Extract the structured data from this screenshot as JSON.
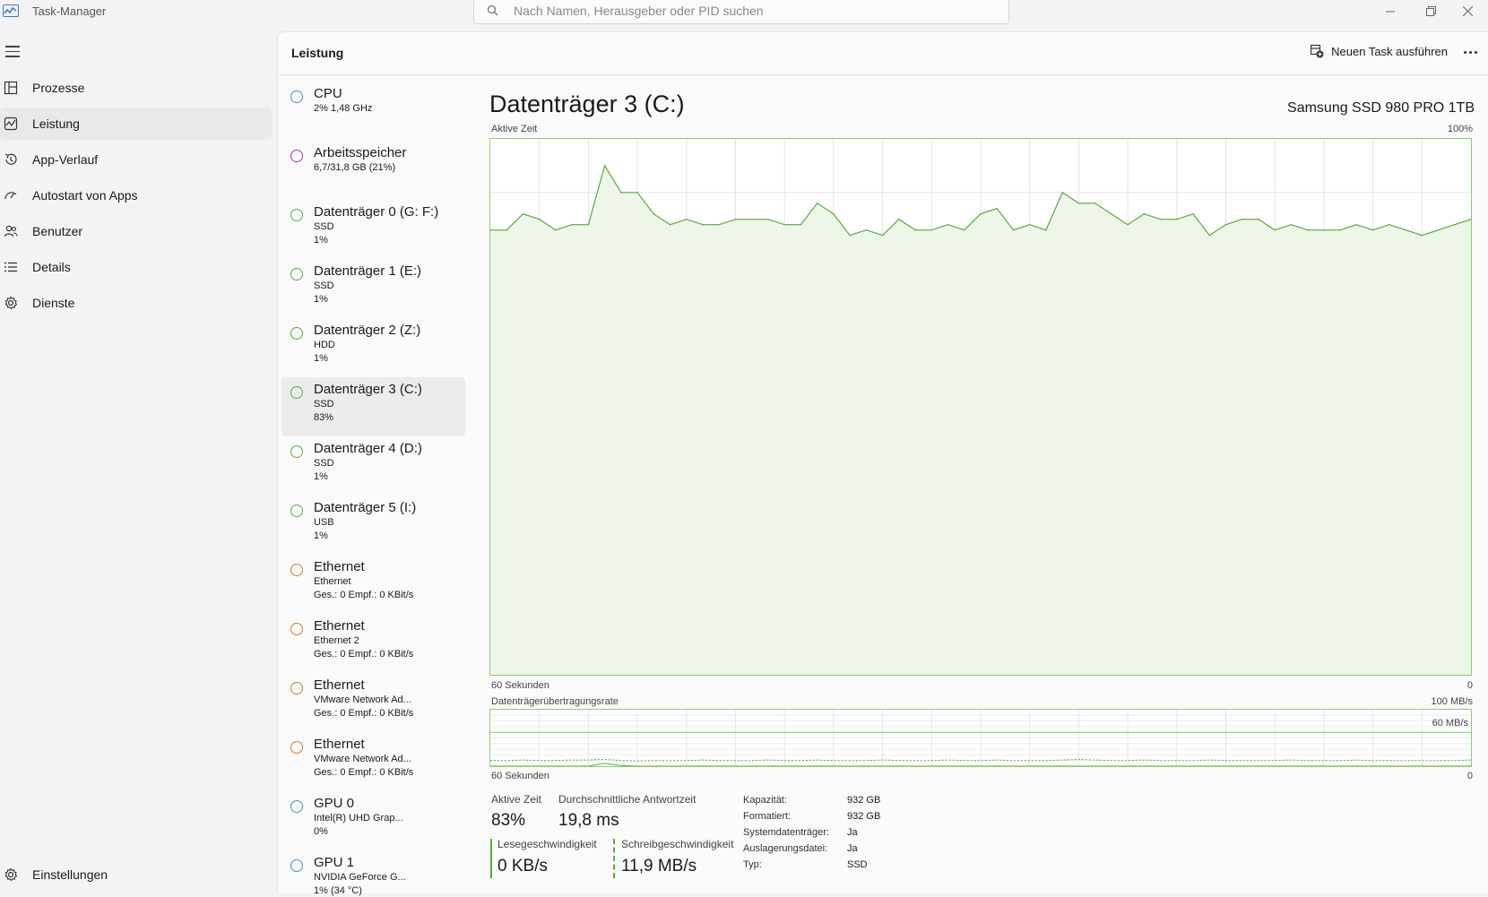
{
  "app": {
    "title": "Task-Manager",
    "search_placeholder": "Nach Namen, Herausgeber oder PID suchen"
  },
  "sidebar": {
    "items": [
      {
        "label": "Prozesse",
        "icon": "processes-icon"
      },
      {
        "label": "Leistung",
        "icon": "performance-icon",
        "active": true
      },
      {
        "label": "App-Verlauf",
        "icon": "history-icon"
      },
      {
        "label": "Autostart von Apps",
        "icon": "startup-icon"
      },
      {
        "label": "Benutzer",
        "icon": "users-icon"
      },
      {
        "label": "Details",
        "icon": "details-icon"
      },
      {
        "label": "Dienste",
        "icon": "services-icon"
      }
    ],
    "settings_label": "Einstellungen"
  },
  "header": {
    "title": "Leistung",
    "new_task_label": "Neuen Task ausführen"
  },
  "devices": [
    {
      "name": "CPU",
      "lines": [
        "2% 1,48 GHz"
      ],
      "color": "#3a8fd8"
    },
    {
      "name": "Arbeitsspeicher",
      "lines": [
        "6,7/31,8 GB (21%)"
      ],
      "color": "#a032c0"
    },
    {
      "name": "Datenträger 0 (G: F:)",
      "lines": [
        "SSD",
        "1%"
      ],
      "color": "#5aaa3a"
    },
    {
      "name": "Datenträger 1 (E:)",
      "lines": [
        "SSD",
        "1%"
      ],
      "color": "#5aaa3a"
    },
    {
      "name": "Datenträger 2 (Z:)",
      "lines": [
        "HDD",
        "1%"
      ],
      "color": "#5aaa3a"
    },
    {
      "name": "Datenträger 3 (C:)",
      "lines": [
        "SSD",
        "83%"
      ],
      "color": "#5aaa3a",
      "selected": true
    },
    {
      "name": "Datenträger 4 (D:)",
      "lines": [
        "SSD",
        "1%"
      ],
      "color": "#5aaa3a"
    },
    {
      "name": "Datenträger 5 (I:)",
      "lines": [
        "USB",
        "1%"
      ],
      "color": "#5aaa3a"
    },
    {
      "name": "Ethernet",
      "lines": [
        "Ethernet",
        "Ges.: 0 Empf.: 0 KBit/s"
      ],
      "color": "#d8782a"
    },
    {
      "name": "Ethernet",
      "lines": [
        "Ethernet 2",
        "Ges.: 0 Empf.: 0 KBit/s"
      ],
      "color": "#d8782a"
    },
    {
      "name": "Ethernet",
      "lines": [
        "VMware Network Ad...",
        "Ges.: 0 Empf.: 0 KBit/s"
      ],
      "color": "#d8782a"
    },
    {
      "name": "Ethernet",
      "lines": [
        "VMware Network Ad...",
        "Ges.: 0 Empf.: 0 KBit/s"
      ],
      "color": "#d8782a"
    },
    {
      "name": "GPU 0",
      "lines": [
        "Intel(R) UHD Grap...",
        "0%"
      ],
      "color": "#3a8fd8"
    },
    {
      "name": "GPU 1",
      "lines": [
        "NVIDIA GeForce G...",
        "1% (34 °C)"
      ],
      "color": "#3a8fd8"
    }
  ],
  "detail": {
    "title": "Datenträger 3 (C:)",
    "model": "Samsung SSD 980 PRO 1TB",
    "chart1_label": "Aktive Zeit",
    "chart1_max": "100%",
    "chart1_time": "60 Sekunden",
    "chart1_min": "0",
    "chart2_label": "Datenträgerübertragungsrate",
    "chart2_max": "100 MB/s",
    "chart2_mid": "60 MB/s",
    "chart2_time": "60 Sekunden",
    "chart2_min": "0",
    "stats": {
      "active_label": "Aktive Zeit",
      "active_value": "83%",
      "response_label": "Durchschnittliche Antwortzeit",
      "response_value": "19,8 ms",
      "read_label": "Lesegeschwindigkeit",
      "read_value": "0 KB/s",
      "write_label": "Schreibgeschwindigkeit",
      "write_value": "11,9 MB/s"
    },
    "properties": [
      {
        "key": "Kapazität:",
        "value": "932 GB"
      },
      {
        "key": "Formatiert:",
        "value": "932 GB"
      },
      {
        "key": "Systemdatenträger:",
        "value": "Ja"
      },
      {
        "key": "Auslagerungsdatei:",
        "value": "Ja"
      },
      {
        "key": "Typ:",
        "value": "SSD"
      }
    ]
  },
  "chart_data": [
    {
      "type": "area",
      "title": "Aktive Zeit",
      "xlabel": "60 Sekunden",
      "ylim": [
        0,
        100
      ],
      "x": [
        60,
        59,
        58,
        57,
        56,
        55,
        54,
        53,
        52,
        51,
        50,
        49,
        48,
        47,
        46,
        45,
        44,
        43,
        42,
        41,
        40,
        39,
        38,
        37,
        36,
        35,
        34,
        33,
        32,
        31,
        30,
        29,
        28,
        27,
        26,
        25,
        24,
        23,
        22,
        21,
        20,
        19,
        18,
        17,
        16,
        15,
        14,
        13,
        12,
        11,
        10,
        9,
        8,
        7,
        6,
        5,
        4,
        3,
        2,
        1,
        0
      ],
      "values": [
        83,
        83,
        86,
        85,
        83,
        84,
        84,
        95,
        90,
        90,
        86,
        84,
        85,
        84,
        84,
        85,
        85,
        85,
        84,
        84,
        88,
        86,
        82,
        83,
        82,
        85,
        83,
        83,
        84,
        83,
        86,
        87,
        83,
        84,
        83,
        90,
        88,
        88,
        86,
        84,
        86,
        85,
        85,
        86,
        82,
        84,
        85,
        85,
        83,
        84,
        83,
        83,
        83,
        84,
        83,
        84,
        83,
        82,
        83,
        84,
        85
      ],
      "color": "#5aaa3a"
    },
    {
      "type": "line",
      "title": "Datenträgerübertragungsrate",
      "xlabel": "60 Sekunden",
      "ylim": [
        0,
        100
      ],
      "x": [
        60,
        59,
        58,
        57,
        56,
        55,
        54,
        53,
        52,
        51,
        50,
        49,
        48,
        47,
        46,
        45,
        44,
        43,
        42,
        41,
        40,
        39,
        38,
        37,
        36,
        35,
        34,
        33,
        32,
        31,
        30,
        29,
        28,
        27,
        26,
        25,
        24,
        23,
        22,
        21,
        20,
        19,
        18,
        17,
        16,
        15,
        14,
        13,
        12,
        11,
        10,
        9,
        8,
        7,
        6,
        5,
        4,
        3,
        2,
        1,
        0
      ],
      "series": [
        {
          "values": [
            10,
            10,
            11,
            10,
            10,
            11,
            11,
            12,
            10,
            9,
            10,
            10,
            10,
            11,
            10,
            10,
            10,
            11,
            10,
            10,
            11,
            10,
            10,
            10,
            11,
            10,
            10,
            10,
            11,
            10,
            10,
            11,
            10,
            10,
            10,
            11,
            12,
            11,
            10,
            10,
            11,
            10,
            10,
            10,
            11,
            10,
            10,
            10,
            10,
            11,
            10,
            10,
            10,
            11,
            10,
            10,
            10,
            10,
            10,
            10,
            11
          ],
          "color": "#5aaa3a",
          "style": "dashed"
        },
        {
          "values": [
            0,
            0,
            0,
            0,
            0,
            0,
            0,
            5,
            1,
            0,
            0,
            0,
            0,
            0,
            0,
            0,
            0,
            0,
            0,
            0,
            0,
            0,
            0,
            0,
            0,
            0,
            0,
            0,
            0,
            0,
            0,
            0,
            0,
            0,
            0,
            0,
            0,
            0,
            0,
            0,
            0,
            0,
            0,
            0,
            0,
            0,
            0,
            0,
            0,
            0,
            0,
            0,
            0,
            0,
            0,
            0,
            0,
            0,
            0,
            0,
            0
          ],
          "color": "#5aaa3a",
          "style": "solid"
        }
      ],
      "reference_line": 60
    }
  ]
}
